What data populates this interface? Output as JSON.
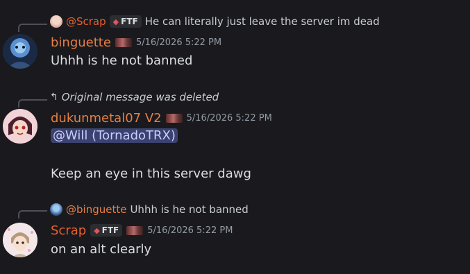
{
  "colors": {
    "background": "#1a1a1e",
    "name_orange": "#e67e45",
    "name_scrap": "#e8602e",
    "mention_bg": "#3c4270",
    "timestamp": "#949ba4"
  },
  "messages": [
    {
      "reply": {
        "name": "@Scrap",
        "tag": "FTF",
        "text": "He can literally just leave the server im dead"
      },
      "author": "binguette",
      "timestamp": "5/16/2026 5:22 PM",
      "lines": [
        "Uhhh is he not banned"
      ]
    },
    {
      "reply": {
        "text": "Original message was deleted"
      },
      "author": "dukunmetal07 V2",
      "timestamp": "5/16/2026 5:22 PM",
      "mention": "@Will (TornadoTRX)",
      "lines": [
        "Keep an eye in this server dawg"
      ]
    },
    {
      "reply": {
        "name": "@binguette",
        "text": "Uhhh is he not banned"
      },
      "author": "Scrap",
      "tag": "FTF",
      "timestamp": "5/16/2026 5:22 PM",
      "lines": [
        "on an alt clearly"
      ]
    }
  ]
}
